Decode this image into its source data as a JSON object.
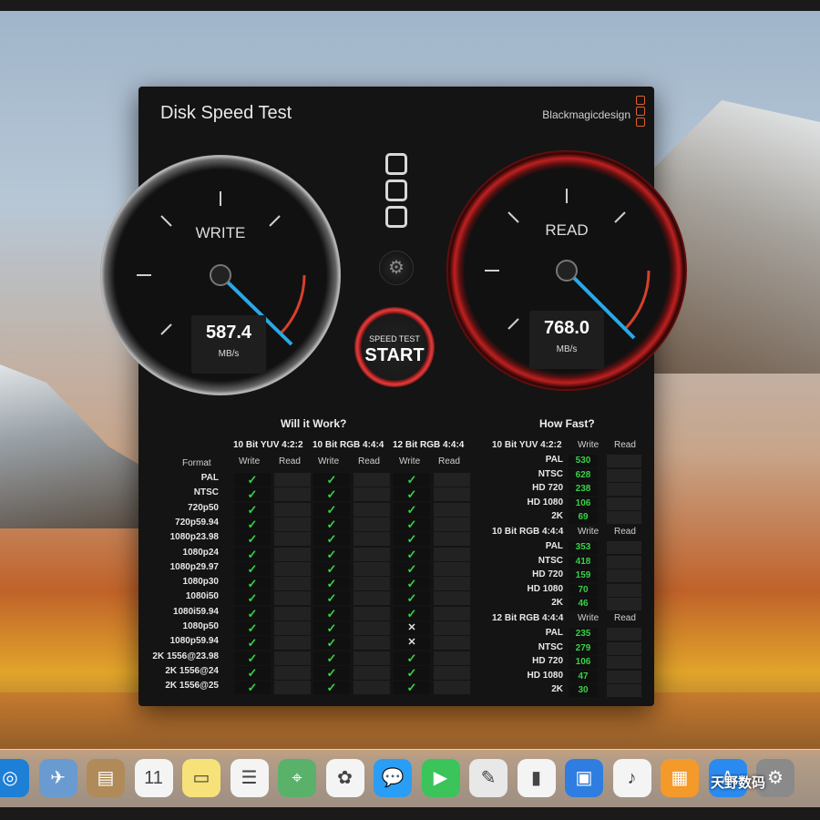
{
  "app": {
    "title": "Disk Speed Test",
    "brand": "Blackmagicdesign",
    "accent_red": "#c02020",
    "check_green": "#37d146"
  },
  "gauges": {
    "write": {
      "label": "WRITE",
      "value": "587.4",
      "unit": "MB/s"
    },
    "read": {
      "label": "READ",
      "value": "768.0",
      "unit": "MB/s"
    }
  },
  "controls": {
    "settings_icon": "gear-icon",
    "start_small": "SPEED TEST",
    "start_big": "START"
  },
  "will_it_work": {
    "title": "Will it Work?",
    "format_header": "Format",
    "groups": [
      "10 Bit YUV 4:2:2",
      "10 Bit RGB 4:4:4",
      "12 Bit RGB 4:4:4"
    ],
    "write_label": "Write",
    "read_label": "Read",
    "check": "✓",
    "cross": "✕",
    "rows": [
      {
        "format": "PAL",
        "g3": "check"
      },
      {
        "format": "NTSC",
        "g3": "check"
      },
      {
        "format": "720p50",
        "g3": "check"
      },
      {
        "format": "720p59.94",
        "g3": "check"
      },
      {
        "format": "1080p23.98",
        "g3": "check"
      },
      {
        "format": "1080p24",
        "g3": "check"
      },
      {
        "format": "1080p29.97",
        "g3": "check"
      },
      {
        "format": "1080p30",
        "g3": "check"
      },
      {
        "format": "1080i50",
        "g3": "check"
      },
      {
        "format": "1080i59.94",
        "g3": "check"
      },
      {
        "format": "1080p50",
        "g3": "cross"
      },
      {
        "format": "1080p59.94",
        "g3": "cross"
      },
      {
        "format": "2K 1556@23.98",
        "g3": "check"
      },
      {
        "format": "2K 1556@24",
        "g3": "check"
      },
      {
        "format": "2K 1556@25",
        "g3": "check"
      }
    ]
  },
  "how_fast": {
    "title": "How Fast?",
    "write_label": "Write",
    "read_label": "Read",
    "sections": [
      {
        "title": "10 Bit YUV 4:2:2",
        "rows": [
          {
            "format": "PAL",
            "write": "530"
          },
          {
            "format": "NTSC",
            "write": "628"
          },
          {
            "format": "HD 720",
            "write": "238"
          },
          {
            "format": "HD 1080",
            "write": "106"
          },
          {
            "format": "2K",
            "write": "69"
          }
        ]
      },
      {
        "title": "10 Bit RGB 4:4:4",
        "rows": [
          {
            "format": "PAL",
            "write": "353"
          },
          {
            "format": "NTSC",
            "write": "418"
          },
          {
            "format": "HD 720",
            "write": "159"
          },
          {
            "format": "HD 1080",
            "write": "70"
          },
          {
            "format": "2K",
            "write": "46"
          }
        ]
      },
      {
        "title": "12 Bit RGB 4:4:4",
        "rows": [
          {
            "format": "PAL",
            "write": "235"
          },
          {
            "format": "NTSC",
            "write": "279"
          },
          {
            "format": "HD 720",
            "write": "106"
          },
          {
            "format": "HD 1080",
            "write": "47"
          },
          {
            "format": "2K",
            "write": "30"
          }
        ]
      }
    ]
  },
  "dock": {
    "calendar_day": "11",
    "watermark": "天野数码",
    "items": [
      "safari-icon",
      "preview-icon",
      "contacts-icon",
      "calendar-icon",
      "notes-icon",
      "reminders-icon",
      "maps-icon",
      "photos-icon",
      "messages-icon",
      "facetime-icon",
      "app-icon",
      "numbers-icon",
      "keynote-icon",
      "music-icon",
      "ibooks-icon",
      "app-store-icon",
      "system-preferences-icon"
    ]
  }
}
